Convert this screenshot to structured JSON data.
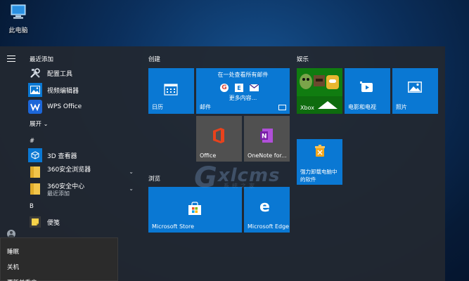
{
  "desktop": {
    "this_pc_label": "此电脑"
  },
  "recent": {
    "header": "最近添加",
    "items": [
      {
        "label": "配置工具",
        "icon": "tools-icon"
      },
      {
        "label": "视频编辑器",
        "icon": "photos-icon"
      },
      {
        "label": "WPS Office",
        "icon": "wps-icon"
      }
    ],
    "expand_label": "展开",
    "expand_chevron": "⌄"
  },
  "groups": {
    "hash": "#",
    "b": "B",
    "hash_items": [
      {
        "label": "3D 查看器",
        "icon": "3d-viewer-icon"
      },
      {
        "label": "360安全浏览器",
        "sub": "",
        "icon": "folder-icon",
        "chevron": "⌄"
      },
      {
        "label": "360安全中心",
        "sub": "最近添加",
        "icon": "folder-icon",
        "chevron": "⌄"
      }
    ],
    "b_items": [
      {
        "label": "便笺",
        "icon": "sticky-notes-icon"
      }
    ]
  },
  "power_menu": {
    "sleep": "睡眠",
    "shutdown": "关机",
    "restart": "更新并重启"
  },
  "tiles": {
    "create_title": "创建",
    "calendar": "日历",
    "mail_header": "在一处查看所有邮件",
    "mail_more": "更多内容...",
    "mail": "邮件",
    "office": "Office",
    "onenote": "OneNote for...",
    "browse_title": "浏览",
    "store": "Microsoft Store",
    "edge": "Microsoft Edge",
    "play_title": "娱乐",
    "xbox": "Xbox",
    "movies": "电影和电视",
    "photos": "照片",
    "uninstall": "强力卸载电脑中的软件"
  },
  "watermark": {
    "g": "G",
    "text": "xlcms",
    "sub": "系统之家"
  },
  "colors": {
    "tile_blue": "#0a78d3",
    "tile_grey": "#505050",
    "start_bg": "#22282f"
  }
}
